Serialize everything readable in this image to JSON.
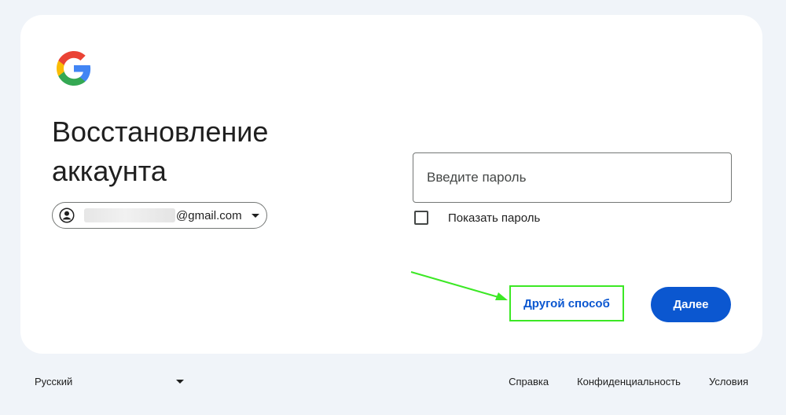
{
  "page": {
    "title": "Восстановление аккаунта"
  },
  "account": {
    "email_suffix": "@gmail.com"
  },
  "password": {
    "placeholder": "Введите пароль",
    "value": ""
  },
  "show_password": {
    "label": "Показать пароль",
    "checked": false
  },
  "actions": {
    "alternative_label": "Другой способ",
    "next_label": "Далее"
  },
  "footer": {
    "language": "Русский",
    "links": [
      "Справка",
      "Конфиденциальность",
      "Условия"
    ]
  },
  "icons": {
    "logo": "google-logo",
    "avatar": "account-circle-icon",
    "dropdown": "caret-down-icon"
  },
  "colors": {
    "primary": "#0b57d0",
    "highlight": "#3ce825",
    "background": "#f0f4f9"
  }
}
